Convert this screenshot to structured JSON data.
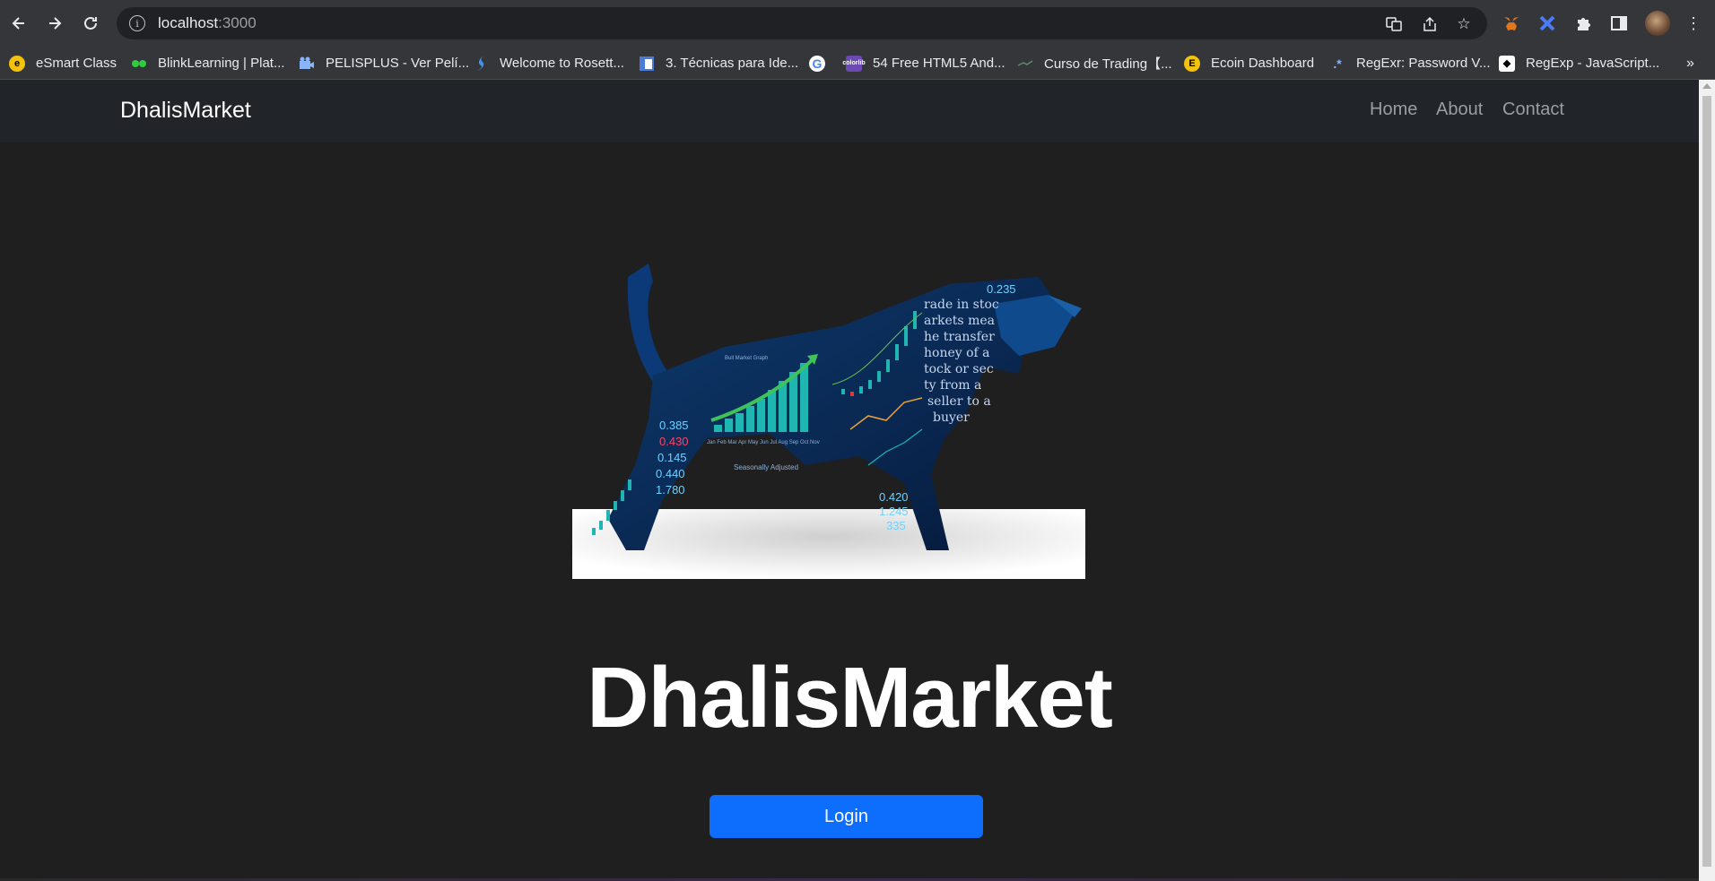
{
  "browser": {
    "url_host": "localhost",
    "url_port": ":3000",
    "bookmarks": [
      {
        "label": "eSmart Class",
        "icon": "esmart-icon",
        "color": "#f4c20d"
      },
      {
        "label": "BlinkLearning | Plat...",
        "icon": "blinklearning-icon",
        "color": "#2ecc40"
      },
      {
        "label": "PELISPLUS - Ver Pelí...",
        "icon": "pelisplus-icon",
        "color": "#8ab4f8"
      },
      {
        "label": "Welcome to Rosett...",
        "icon": "rosetta-icon",
        "color": "#4a90e2"
      },
      {
        "label": "3. Técnicas para Ide...",
        "icon": "doc-icon",
        "color": "#8ab4f8"
      },
      {
        "label": "",
        "icon": "google-icon",
        "color": "#ffffff"
      },
      {
        "label": "54 Free HTML5 And...",
        "icon": "colorlib-icon",
        "color": "#6c4ab6"
      },
      {
        "label": "Curso de Trading【...",
        "icon": "trading-icon",
        "color": "#5f6368"
      },
      {
        "label": "Ecoin Dashboard",
        "icon": "ecoin-icon",
        "color": "#f4c20d"
      },
      {
        "label": "RegExr: Password V...",
        "icon": "regexr-icon",
        "color": "#8ab4f8"
      },
      {
        "label": "RegExp - JavaScript...",
        "icon": "regexp-icon",
        "color": "#ffffff"
      }
    ],
    "more_bookmarks": "»"
  },
  "navbar": {
    "brand": "DhalisMarket",
    "links": [
      "Home",
      "About",
      "Contact"
    ]
  },
  "hero": {
    "title": "DhalisMarket",
    "login_label": "Login",
    "image": {
      "body_text": [
        "rade in stoc",
        "arkets mea",
        "he transfer",
        "honey of a",
        "tock or sec",
        "ty from a",
        "seller to a",
        "buyer"
      ],
      "ticker_values": [
        "0.235",
        "0.385",
        "0.430",
        "0.145",
        "0.440",
        "1.780",
        "0.420",
        "1.245",
        "335"
      ],
      "chart_caption": "Bull Market Graph",
      "chart_footer": "Seasonally Adjusted",
      "months": "Jan Feb Mar Apr May Jun Jul Aug Sep Oct Nov"
    }
  },
  "colors": {
    "navbar_bg": "#212529",
    "page_bg": "#1f1f1f",
    "primary": "#0d6efd",
    "chrome_bg": "#35363a"
  }
}
